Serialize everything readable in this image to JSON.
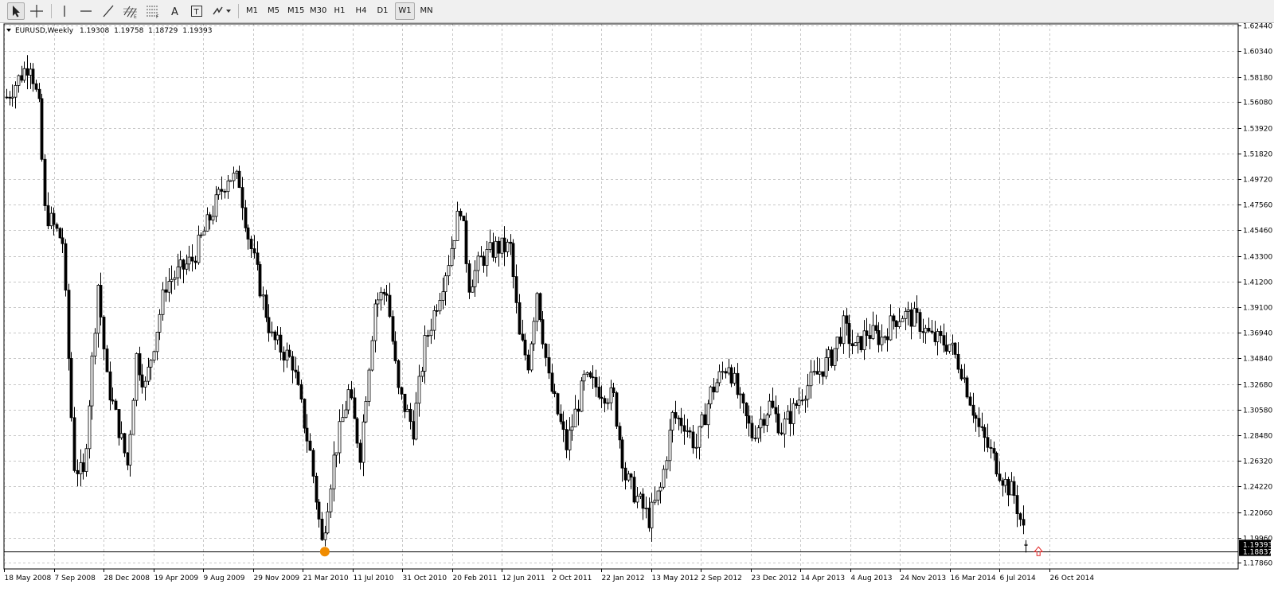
{
  "toolbar": {
    "tools": [
      {
        "name": "cursor-tool",
        "icon": "arrow-cursor-icon",
        "active": true
      },
      {
        "name": "crosshair-tool",
        "icon": "crosshair-icon",
        "active": false
      },
      {
        "name": "vertical-line-tool",
        "icon": "vertical-line-icon",
        "active": false
      },
      {
        "name": "horizontal-line-tool",
        "icon": "horizontal-line-icon",
        "active": false
      },
      {
        "name": "trendline-tool",
        "icon": "trendline-icon",
        "active": false
      },
      {
        "name": "equidistant-channel-tool",
        "icon": "equidistant-channel-icon",
        "active": false
      },
      {
        "name": "fibonacci-tool",
        "icon": "fibonacci-retracement-icon",
        "active": false
      },
      {
        "name": "text-tool",
        "icon": "text-icon",
        "active": false
      },
      {
        "name": "text-label-tool",
        "icon": "text-label-icon",
        "active": false
      },
      {
        "name": "arrows-tool",
        "icon": "arrows-dropdown-icon",
        "active": false
      }
    ],
    "timeframes": [
      "M1",
      "M5",
      "M15",
      "M30",
      "H1",
      "H4",
      "D1",
      "W1",
      "MN"
    ],
    "active_timeframe": "W1"
  },
  "chart_data": {
    "type": "candlestick",
    "info": {
      "symbol": "EURUSD,Weekly",
      "open": "1.19308",
      "high": "1.19758",
      "low": "1.18729",
      "close": "1.19393"
    },
    "y_axis": {
      "min": 1.1776,
      "max": 1.6244,
      "ticks": [
        "1.62440",
        "1.60340",
        "1.58180",
        "1.56080",
        "1.53920",
        "1.51820",
        "1.49720",
        "1.47560",
        "1.45460",
        "1.43300",
        "1.41200",
        "1.39100",
        "1.36940",
        "1.34840",
        "1.32680",
        "1.30580",
        "1.28480",
        "1.26320",
        "1.24220",
        "1.22060",
        "1.19960",
        "1.17860"
      ]
    },
    "x_axis_labels": [
      "18 May 2008",
      "7 Sep 2008",
      "28 Dec 2008",
      "19 Apr 2009",
      "9 Aug 2009",
      "29 Nov 2009",
      "21 Mar 2010",
      "11 Jul 2010",
      "31 Oct 2010",
      "20 Feb 2011",
      "12 Jun 2011",
      "2 Oct 2011",
      "22 Jan 2012",
      "13 May 2012",
      "2 Sep 2012",
      "23 Dec 2012",
      "14 Apr 2013",
      "4 Aug 2013",
      "24 Nov 2013",
      "16 Mar 2014",
      "6 Jul 2014",
      "26 Oct 2014"
    ],
    "price_labels": {
      "bid": "1.19393",
      "line": "1.18837"
    },
    "horizontal_line_price": 1.18837,
    "price_path": [
      {
        "date": "2008-05-18",
        "price": 1.565
      },
      {
        "date": "2008-07-13",
        "price": 1.595
      },
      {
        "date": "2008-08-03",
        "price": 1.555
      },
      {
        "date": "2008-08-17",
        "price": 1.47
      },
      {
        "date": "2008-09-28",
        "price": 1.445
      },
      {
        "date": "2008-10-19",
        "price": 1.3
      },
      {
        "date": "2008-10-26",
        "price": 1.26
      },
      {
        "date": "2008-11-16",
        "price": 1.25
      },
      {
        "date": "2008-12-21",
        "price": 1.41
      },
      {
        "date": "2009-01-11",
        "price": 1.33
      },
      {
        "date": "2009-03-01",
        "price": 1.26
      },
      {
        "date": "2009-03-22",
        "price": 1.35
      },
      {
        "date": "2009-04-12",
        "price": 1.325
      },
      {
        "date": "2009-05-31",
        "price": 1.41
      },
      {
        "date": "2009-08-02",
        "price": 1.43
      },
      {
        "date": "2009-09-13",
        "price": 1.465
      },
      {
        "date": "2009-10-25",
        "price": 1.5
      },
      {
        "date": "2009-11-22",
        "price": 1.495
      },
      {
        "date": "2009-12-13",
        "price": 1.45
      },
      {
        "date": "2010-02-07",
        "price": 1.365
      },
      {
        "date": "2010-03-28",
        "price": 1.345
      },
      {
        "date": "2010-05-09",
        "price": 1.27
      },
      {
        "date": "2010-06-06",
        "price": 1.195
      },
      {
        "date": "2010-07-04",
        "price": 1.265
      },
      {
        "date": "2010-08-08",
        "price": 1.32
      },
      {
        "date": "2010-09-05",
        "price": 1.27
      },
      {
        "date": "2010-10-10",
        "price": 1.395
      },
      {
        "date": "2010-11-07",
        "price": 1.405
      },
      {
        "date": "2010-12-05",
        "price": 1.32
      },
      {
        "date": "2011-01-09",
        "price": 1.29
      },
      {
        "date": "2011-02-06",
        "price": 1.36
      },
      {
        "date": "2011-04-03",
        "price": 1.43
      },
      {
        "date": "2011-05-01",
        "price": 1.475
      },
      {
        "date": "2011-05-22",
        "price": 1.41
      },
      {
        "date": "2011-06-19",
        "price": 1.43
      },
      {
        "date": "2011-07-24",
        "price": 1.44
      },
      {
        "date": "2011-08-28",
        "price": 1.44
      },
      {
        "date": "2011-09-18",
        "price": 1.365
      },
      {
        "date": "2011-10-09",
        "price": 1.345
      },
      {
        "date": "2011-10-30",
        "price": 1.405
      },
      {
        "date": "2011-11-27",
        "price": 1.33
      },
      {
        "date": "2012-01-08",
        "price": 1.275
      },
      {
        "date": "2012-02-19",
        "price": 1.33
      },
      {
        "date": "2012-03-18",
        "price": 1.325
      },
      {
        "date": "2012-04-29",
        "price": 1.315
      },
      {
        "date": "2012-05-27",
        "price": 1.25
      },
      {
        "date": "2012-07-22",
        "price": 1.215
      },
      {
        "date": "2012-08-19",
        "price": 1.24
      },
      {
        "date": "2012-09-16",
        "price": 1.3
      },
      {
        "date": "2012-10-14",
        "price": 1.295
      },
      {
        "date": "2012-11-11",
        "price": 1.275
      },
      {
        "date": "2012-12-16",
        "price": 1.32
      },
      {
        "date": "2013-01-27",
        "price": 1.345
      },
      {
        "date": "2013-02-24",
        "price": 1.31
      },
      {
        "date": "2013-03-24",
        "price": 1.285
      },
      {
        "date": "2013-05-05",
        "price": 1.31
      },
      {
        "date": "2013-06-02",
        "price": 1.29
      },
      {
        "date": "2013-06-30",
        "price": 1.305
      },
      {
        "date": "2013-07-21",
        "price": 1.32
      },
      {
        "date": "2013-08-25",
        "price": 1.335
      },
      {
        "date": "2013-09-29",
        "price": 1.35
      },
      {
        "date": "2013-10-27",
        "price": 1.375
      },
      {
        "date": "2013-11-24",
        "price": 1.355
      },
      {
        "date": "2013-12-22",
        "price": 1.37
      },
      {
        "date": "2014-01-26",
        "price": 1.365
      },
      {
        "date": "2014-02-23",
        "price": 1.38
      },
      {
        "date": "2014-03-16",
        "price": 1.385
      },
      {
        "date": "2014-04-20",
        "price": 1.38
      },
      {
        "date": "2014-05-25",
        "price": 1.365
      },
      {
        "date": "2014-07-06",
        "price": 1.36
      },
      {
        "date": "2014-08-03",
        "price": 1.34
      },
      {
        "date": "2014-09-14",
        "price": 1.29
      },
      {
        "date": "2014-10-19",
        "price": 1.265
      },
      {
        "date": "2014-11-16",
        "price": 1.245
      },
      {
        "date": "2014-12-07",
        "price": 1.235
      },
      {
        "date": "2014-12-28",
        "price": 1.205
      },
      {
        "date": "2015-01-04",
        "price": 1.194
      }
    ],
    "current_candle": {
      "open": 1.19308,
      "high": 1.19758,
      "low": 1.18729,
      "close": 1.19393
    },
    "marker_low_price": 1.188,
    "arrow_price": 1.188
  },
  "colors": {
    "background": "#ffffff",
    "grid": "#c8c8c8",
    "candle": "#000000",
    "bid_label_bg": "#000000",
    "bid_label_text": "#ffffff",
    "marker": "#f08c00",
    "arrow": "#e02020"
  }
}
